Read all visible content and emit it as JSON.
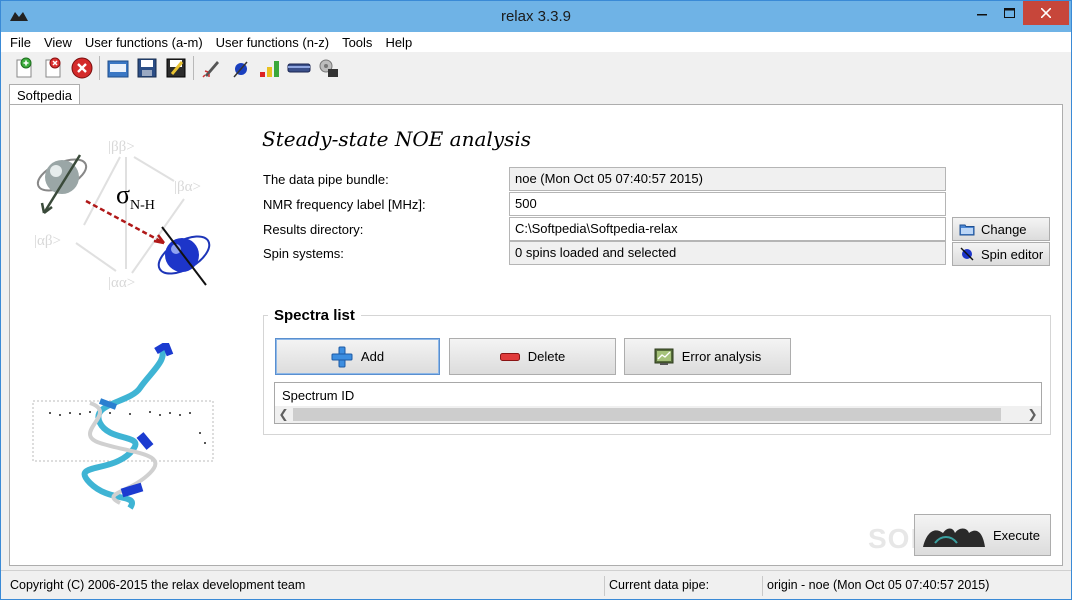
{
  "window": {
    "title": "relax 3.3.9"
  },
  "menu": [
    "File",
    "View",
    "User functions (a-m)",
    "User functions (n-z)",
    "Tools",
    "Help"
  ],
  "tabs": [
    {
      "label": "Softpedia"
    }
  ],
  "analysis": {
    "heading": "Steady-state NOE analysis",
    "fields": {
      "pipe_bundle": {
        "label": "The data pipe bundle:",
        "value": "noe (Mon Oct 05 07:40:57 2015)"
      },
      "nmr_freq": {
        "label": "NMR frequency label [MHz]:",
        "value": "500"
      },
      "results_dir": {
        "label": "Results directory:",
        "value": "C:\\Softpedia\\Softpedia-relax"
      },
      "spin_systems": {
        "label": "Spin systems:",
        "value": "0 spins loaded and selected"
      }
    },
    "change_button": "Change",
    "spin_editor_button": "Spin editor"
  },
  "diagram": {
    "sigma": "σ",
    "sigma_sub": "N-H",
    "states": [
      "|ββ>",
      "|βα>",
      "|αβ>",
      "|αα>"
    ]
  },
  "spectra": {
    "title": "Spectra list",
    "add_button": "Add",
    "delete_button": "Delete",
    "error_button": "Error analysis",
    "column_header": "Spectrum ID"
  },
  "execute_button": "Execute",
  "watermark": "SOFTPEDIA",
  "status": {
    "copyright": "Copyright (C) 2006-2015 the relax development team",
    "pipe_label": "Current data pipe:",
    "pipe_value": "origin - noe (Mon Oct 05 07:40:57 2015)"
  },
  "colors": {
    "titlebar": "#6fb3e6",
    "close": "#c7463a",
    "accent_blue": "#2a6fd6"
  }
}
